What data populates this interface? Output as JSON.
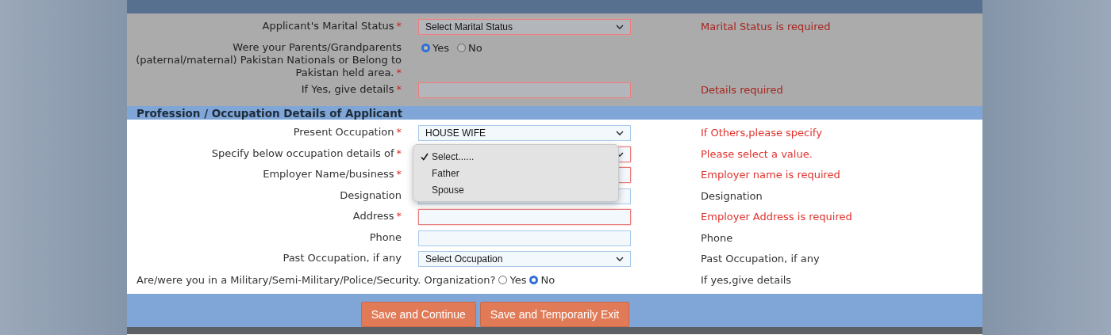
{
  "personal": {
    "dimmed": true,
    "rows": [
      {
        "kind": "select",
        "label": "Applicant's Marital Status",
        "mark": "*",
        "value": "Select Marital Status",
        "invalid": true,
        "hint": "Marital Status is required",
        "hint_error": true
      },
      {
        "kind": "radio",
        "label": "Were your Parents/Grandparents (paternal/maternal) Pakistan Nationals or Belong to Pakistan held area.",
        "mark": "*",
        "options": [
          {
            "label": "Yes",
            "selected": true
          },
          {
            "label": "No",
            "selected": false
          }
        ]
      },
      {
        "kind": "input",
        "label": "If Yes, give details",
        "mark": "*",
        "invalid": true,
        "hint": "Details required",
        "hint_error": true
      }
    ]
  },
  "profession": {
    "title": "Profession / Occupation Details of Applicant",
    "rows": [
      {
        "kind": "select",
        "label": "Present Occupation",
        "mark": "*",
        "value": "HOUSE WIFE",
        "invalid": false,
        "hint": "If Others,please specify",
        "hint_error": true
      },
      {
        "kind": "select",
        "label": "Specify below occupation details of",
        "mark": "*",
        "invalid": true,
        "hint": "Please select a value.",
        "hint_error": true
      },
      {
        "kind": "input",
        "label": "Employer Name/business",
        "mark": "*",
        "invalid": true,
        "hint": "Employer name is required",
        "hint_error": true
      },
      {
        "kind": "input",
        "label": "Designation",
        "invalid": false,
        "hint": "Designation",
        "hint_error": false
      },
      {
        "kind": "input",
        "label": "Address",
        "mark": "*",
        "invalid": true,
        "hint": "Employer Address is required",
        "hint_error": true
      },
      {
        "kind": "input",
        "label": "Phone",
        "invalid": false,
        "hint": "Phone",
        "hint_error": false
      },
      {
        "kind": "select",
        "label": "Past Occupation, if any",
        "value": "Select Occupation",
        "invalid": false,
        "hint": "Past Occupation, if any",
        "hint_error": false
      },
      {
        "kind": "wide_radio",
        "label": "Are/were you in a Military/Semi-Military/Police/Security. Organization?",
        "options": [
          {
            "label": "Yes",
            "selected": false
          },
          {
            "label": "No",
            "selected": true
          }
        ],
        "hint": "If yes,give details",
        "hint_error": false
      }
    ]
  },
  "dropdown": {
    "options": [
      {
        "label": "Select......",
        "selected": true
      },
      {
        "label": "Father",
        "selected": false
      },
      {
        "label": "Spouse",
        "selected": false
      }
    ]
  },
  "buttons": [
    "Save and Continue",
    "Save and Temporarily Exit"
  ]
}
